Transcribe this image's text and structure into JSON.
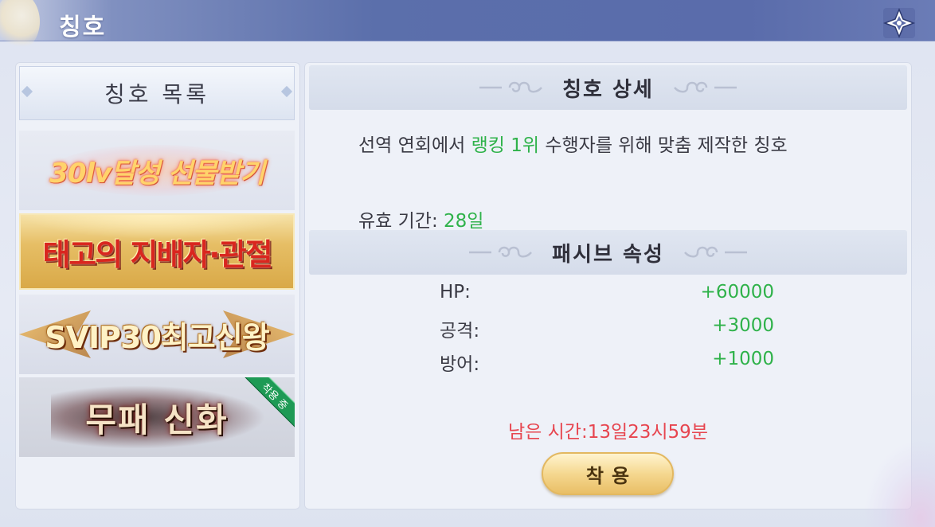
{
  "header": {
    "title": "칭호"
  },
  "left": {
    "title": "칭호 목록",
    "items": [
      {
        "label": "30lv달성 선물받기"
      },
      {
        "label": "태고의 지배자·관절"
      },
      {
        "label": "SVIP30최고신왕"
      },
      {
        "label": "무패 신화",
        "badge": "착용 중"
      }
    ]
  },
  "right": {
    "detail_title": "칭호 상세",
    "desc_pre": "선역 연회에서 ",
    "desc_highlight": "랭킹 1위",
    "desc_post": " 수행자를 위해 맞춤 제작한 칭호",
    "validity_label": "유효 기간: ",
    "validity_value": "28일",
    "passive_title": "패시브 속성",
    "attributes": [
      {
        "label": "HP:",
        "value": "+60000"
      },
      {
        "label": "공격:",
        "value": "+3000"
      },
      {
        "label": "방어:",
        "value": "+1000"
      }
    ],
    "remaining": "남은 시간:13일23시59분",
    "equip_button": "착용"
  },
  "colors": {
    "header_bg": "#5b6fab",
    "highlight_green": "#2fb24a",
    "remaining_red": "#e7454f",
    "button_gold": "#f5d890",
    "equipped_badge": "#1e9a55"
  },
  "icons": {
    "close": "close-x-icon",
    "ornament": "swirl-ornament-icon"
  }
}
